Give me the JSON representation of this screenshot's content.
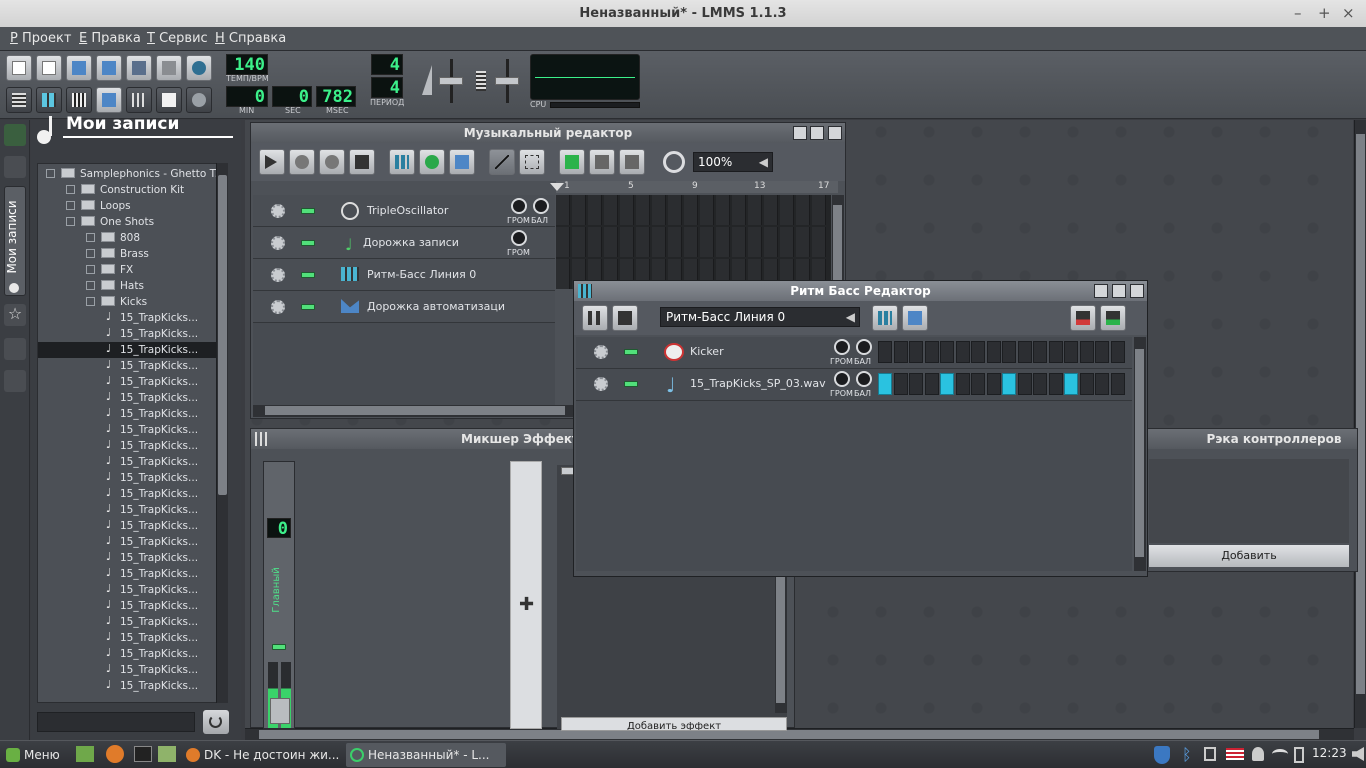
{
  "window": {
    "title": "Неназванный* - LMMS 1.1.3"
  },
  "menubar": {
    "items": [
      "Проект",
      "Правка",
      "Сервис",
      "Справка"
    ],
    "mnemonics": [
      "Р",
      "Е",
      "Т",
      "Н"
    ]
  },
  "toolbar": {
    "tempo": "140",
    "tempo_label": "ТЕМП/BPM",
    "time_min": "0",
    "time_sec": "0",
    "time_msec": "782",
    "label_min": "MIN",
    "label_sec": "SEC",
    "label_msec": "MSEC",
    "timesig_num": "4",
    "timesig_den": "4",
    "timesig_label": "ПЕРИОД",
    "cpu_label": "CPU"
  },
  "browser": {
    "title": "Мои записи",
    "side_tab_label": "Мои записи",
    "tree": [
      {
        "label": "Samplephonics - Ghetto T...",
        "depth": 0,
        "kind": "folder"
      },
      {
        "label": "Construction Kit",
        "depth": 1,
        "kind": "folder"
      },
      {
        "label": "Loops",
        "depth": 1,
        "kind": "folder"
      },
      {
        "label": "One Shots",
        "depth": 1,
        "kind": "folder"
      },
      {
        "label": "808",
        "depth": 2,
        "kind": "folder"
      },
      {
        "label": "Brass",
        "depth": 2,
        "kind": "folder"
      },
      {
        "label": "FX",
        "depth": 2,
        "kind": "folder"
      },
      {
        "label": "Hats",
        "depth": 2,
        "kind": "folder"
      },
      {
        "label": "Kicks",
        "depth": 2,
        "kind": "folder"
      },
      {
        "label": "15_TrapKicks...",
        "depth": 3,
        "kind": "file"
      },
      {
        "label": "15_TrapKicks...",
        "depth": 3,
        "kind": "file"
      },
      {
        "label": "15_TrapKicks...",
        "depth": 3,
        "kind": "file",
        "selected": true
      },
      {
        "label": "15_TrapKicks...",
        "depth": 3,
        "kind": "file"
      },
      {
        "label": "15_TrapKicks...",
        "depth": 3,
        "kind": "file"
      },
      {
        "label": "15_TrapKicks...",
        "depth": 3,
        "kind": "file"
      },
      {
        "label": "15_TrapKicks...",
        "depth": 3,
        "kind": "file"
      },
      {
        "label": "15_TrapKicks...",
        "depth": 3,
        "kind": "file"
      },
      {
        "label": "15_TrapKicks...",
        "depth": 3,
        "kind": "file"
      },
      {
        "label": "15_TrapKicks...",
        "depth": 3,
        "kind": "file"
      },
      {
        "label": "15_TrapKicks...",
        "depth": 3,
        "kind": "file"
      },
      {
        "label": "15_TrapKicks...",
        "depth": 3,
        "kind": "file"
      },
      {
        "label": "15_TrapKicks...",
        "depth": 3,
        "kind": "file"
      },
      {
        "label": "15_TrapKicks...",
        "depth": 3,
        "kind": "file"
      },
      {
        "label": "15_TrapKicks...",
        "depth": 3,
        "kind": "file"
      },
      {
        "label": "15_TrapKicks...",
        "depth": 3,
        "kind": "file"
      },
      {
        "label": "15_TrapKicks...",
        "depth": 3,
        "kind": "file"
      },
      {
        "label": "15_TrapKicks...",
        "depth": 3,
        "kind": "file"
      },
      {
        "label": "15_TrapKicks...",
        "depth": 3,
        "kind": "file"
      },
      {
        "label": "15_TrapKicks...",
        "depth": 3,
        "kind": "file"
      },
      {
        "label": "15_TrapKicks...",
        "depth": 3,
        "kind": "file"
      },
      {
        "label": "15_TrapKicks...",
        "depth": 3,
        "kind": "file"
      },
      {
        "label": "15_TrapKicks...",
        "depth": 3,
        "kind": "file"
      },
      {
        "label": "15_TrapKicks...",
        "depth": 3,
        "kind": "file"
      }
    ]
  },
  "song_editor": {
    "title": "Музыкальный редактор",
    "zoom": "100%",
    "bar_labels": [
      "1",
      "5",
      "9",
      "13",
      "17"
    ],
    "tracks": [
      {
        "name": "TripleOscillator",
        "knob_labels": [
          "ГРОМ",
          "БАЛ"
        ]
      },
      {
        "name": "Дорожка записи",
        "knob_labels": [
          "ГРОМ"
        ]
      },
      {
        "name": "Ритм-Басс Линия 0",
        "knob_labels": []
      },
      {
        "name": "Дорожка автоматизаци",
        "knob_labels": []
      }
    ]
  },
  "bb_editor": {
    "title": "Ритм Басс Редактор",
    "selected_pattern": "Ритм-Басс Линия 0",
    "tracks": [
      {
        "name": "Kicker",
        "knob_labels": [
          "ГРОМ",
          "БАЛ"
        ],
        "steps": [
          0,
          0,
          0,
          0,
          0,
          0,
          0,
          0,
          0,
          0,
          0,
          0,
          0,
          0,
          0,
          0
        ]
      },
      {
        "name": "15_TrapKicks_SP_03.wav",
        "knob_labels": [
          "ГРОМ",
          "БАЛ"
        ],
        "steps": [
          1,
          0,
          0,
          0,
          1,
          0,
          0,
          0,
          1,
          0,
          0,
          0,
          1,
          0,
          0,
          0
        ]
      }
    ]
  },
  "fx_mixer": {
    "title": "Микшер Эффекто",
    "channel_number": "0",
    "channel_name": "Главный",
    "add_effect_label": "Добавить эффект"
  },
  "controller_rack": {
    "title": "Рэка контроллеров",
    "add_label": "Добавить"
  },
  "taskbar": {
    "menu_label": "Меню",
    "tasks": [
      "DK - Не достоин жи...",
      "Неназванный* - L..."
    ],
    "clock": "12:23"
  }
}
